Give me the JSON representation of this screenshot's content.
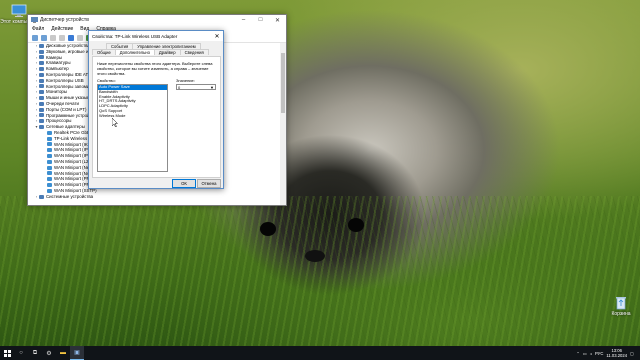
{
  "desktop": {
    "icons": [
      {
        "label": "Этот компьютер",
        "icon": "computer-icon"
      },
      {
        "label": "Корзина",
        "icon": "recycle-bin-icon"
      }
    ]
  },
  "device_manager": {
    "title": "Диспетчер устройств",
    "menu": [
      "Файл",
      "Действие",
      "Вид",
      "Справка"
    ],
    "tree": [
      {
        "label": "Дисковые устройства",
        "expand": ">",
        "net": false
      },
      {
        "label": "Звуковые, игровые и видеоустройства",
        "expand": ">",
        "net": false
      },
      {
        "label": "Камеры",
        "expand": ">",
        "net": false
      },
      {
        "label": "Клавиатуры",
        "expand": ">",
        "net": false
      },
      {
        "label": "Компьютер",
        "expand": ">",
        "net": false
      },
      {
        "label": "Контроллеры IDE ATA/ATAPI",
        "expand": ">",
        "net": false
      },
      {
        "label": "Контроллеры USB",
        "expand": ">",
        "net": false
      },
      {
        "label": "Контроллеры запоминающих устройств",
        "expand": ">",
        "net": false
      },
      {
        "label": "Мониторы",
        "expand": ">",
        "net": false
      },
      {
        "label": "Мыши и иные указывающие устройства",
        "expand": ">",
        "net": false
      },
      {
        "label": "Очереди печати",
        "expand": ">",
        "net": false
      },
      {
        "label": "Порты (COM и LPT)",
        "expand": ">",
        "net": false
      },
      {
        "label": "Программные устройства",
        "expand": ">",
        "net": false
      },
      {
        "label": "Процессоры",
        "expand": ">",
        "net": false
      },
      {
        "label": "Сетевые адаптеры",
        "expand": "v",
        "net": false
      },
      {
        "label": "Realtek PCIe GbE Family Controller",
        "expand": "",
        "net": true
      },
      {
        "label": "TP-Link Wireless USB Adapter",
        "expand": "",
        "net": true
      },
      {
        "label": "WAN Miniport (IKEv2)",
        "expand": "",
        "net": true
      },
      {
        "label": "WAN Miniport (IP)",
        "expand": "",
        "net": true
      },
      {
        "label": "WAN Miniport (IPv6)",
        "expand": "",
        "net": true
      },
      {
        "label": "WAN Miniport (L2TP)",
        "expand": "",
        "net": true
      },
      {
        "label": "WAN Miniport (Network Monitor)",
        "expand": "",
        "net": true
      },
      {
        "label": "WAN Miniport (NAT)",
        "expand": "",
        "net": true
      },
      {
        "label": "WAN Miniport (PPPOE)",
        "expand": "",
        "net": true
      },
      {
        "label": "WAN Miniport (PPTP)",
        "expand": "",
        "net": true
      },
      {
        "label": "WAN Miniport (SSTP)",
        "expand": "",
        "net": true
      },
      {
        "label": "Системные устройства",
        "expand": ">",
        "net": false
      }
    ]
  },
  "properties_dialog": {
    "title": "Свойства: TP-Link Wireless USB Adapter",
    "tabs_top": [
      "События",
      "Управление электропитанием"
    ],
    "tabs_bottom": [
      "Общие",
      "Дополнительно",
      "Драйвер",
      "Сведения"
    ],
    "active_tab": "Дополнительно",
    "description": "Ниже перечислены свойства этого адаптера. Выберите слева свойство, которое вы хотите изменить, а справа – значение этого свойства.",
    "property_label": "Свойство:",
    "value_label": "Значение:",
    "properties": [
      "Auto Power Save",
      "Bandwidth",
      "Enable Adaptivity",
      "HT_DRTS Adaptivity",
      "LDPC Adaptivity",
      "QoS Support",
      "Wireless Mode"
    ],
    "selected_property": "Auto Power Save",
    "value": "0",
    "ok": "ОК",
    "cancel": "Отмена"
  },
  "taskbar": {
    "lang": "РУС",
    "time": "13:06",
    "date": "11.03.2024"
  }
}
